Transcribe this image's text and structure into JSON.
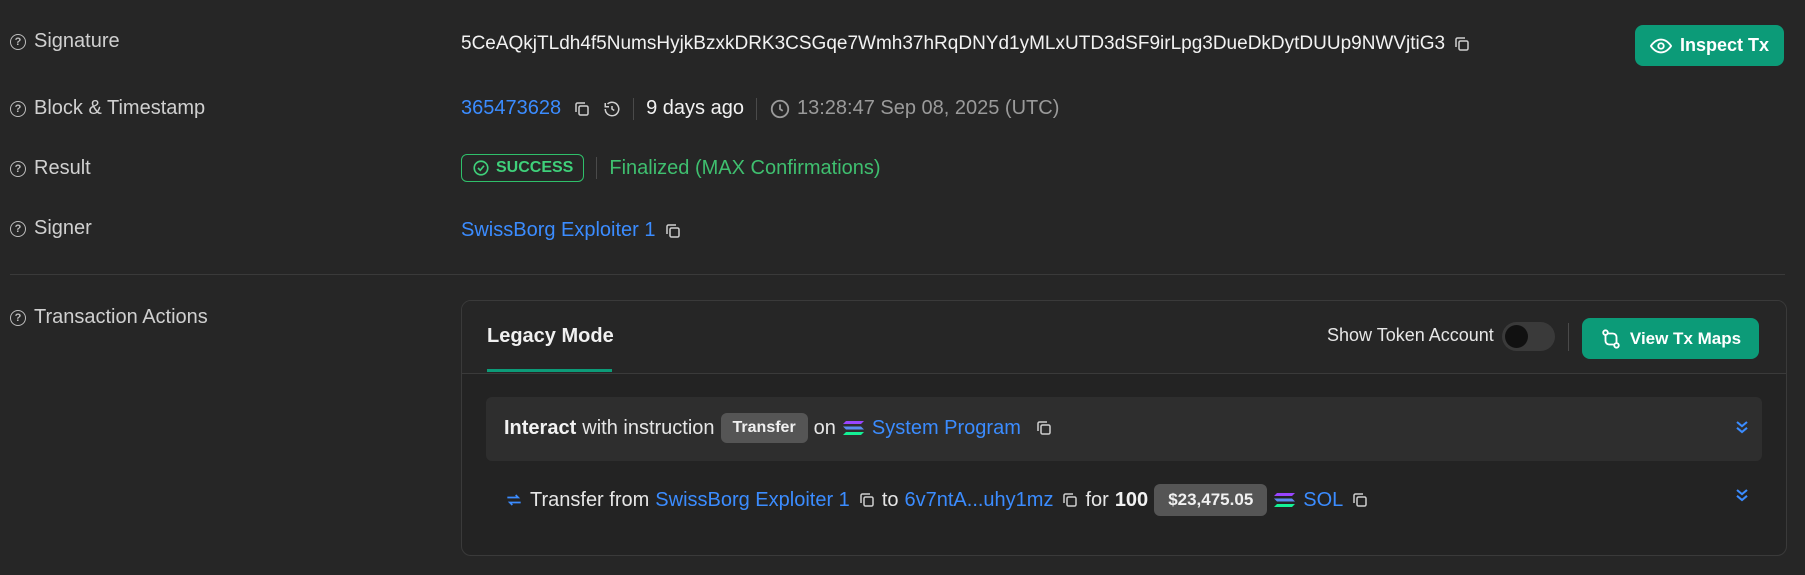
{
  "signature": {
    "label": "Signature",
    "value": "5CeAQkjTLdh4f5NumsHyjkBzxkDRK3CSGqe7Wmh37hRqDNYd1yMLxUTD3dSF9irLpg3DueDkDytDUUp9NWVjtiG3",
    "inspect_button": "Inspect Tx"
  },
  "block": {
    "label": "Block & Timestamp",
    "number": "365473628",
    "relative": "9 days ago",
    "timestamp": "13:28:47 Sep 08, 2025 (UTC)"
  },
  "result": {
    "label": "Result",
    "status": "SUCCESS",
    "finality": "Finalized (MAX Confirmations)"
  },
  "signer": {
    "label": "Signer",
    "name": "SwissBorg Exploiter 1"
  },
  "actions": {
    "label": "Transaction Actions",
    "tab": "Legacy Mode",
    "toggle_label": "Show Token Account",
    "view_maps_button": "View Tx Maps",
    "instruction": {
      "interact": "Interact",
      "with_text": "with instruction",
      "chip": "Transfer",
      "on_text": "on",
      "program": "System Program"
    },
    "transfer": {
      "prefix": "Transfer from",
      "from": "SwissBorg Exploiter 1",
      "to_text": "to",
      "to": "6v7ntA...uhy1mz",
      "for_text": "for",
      "amount": "100",
      "usd": "$23,475.05",
      "token": "SOL"
    }
  },
  "colors": {
    "accent": "#0c9b78",
    "link": "#3b8cff",
    "success": "#3fd07a",
    "background": "#262626"
  }
}
